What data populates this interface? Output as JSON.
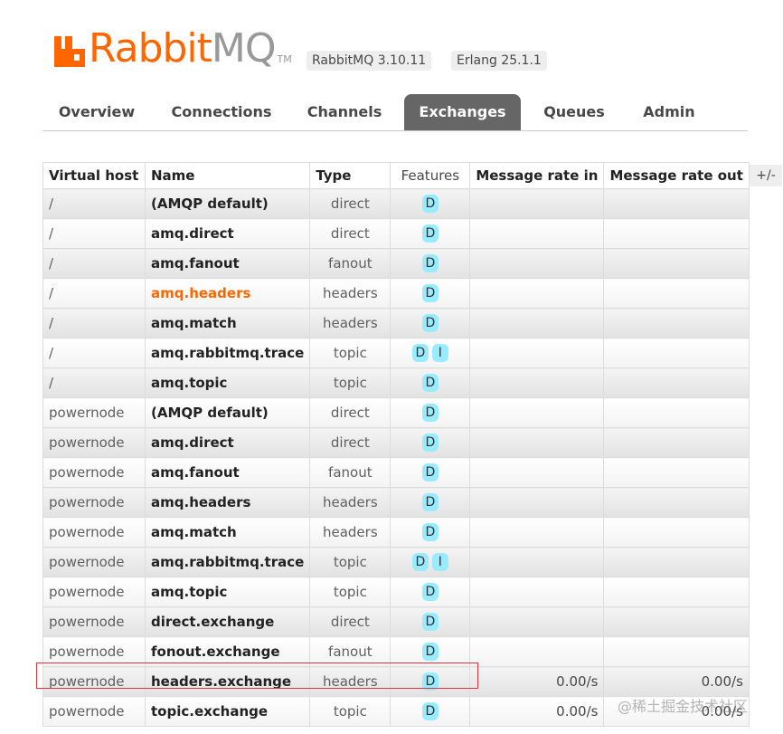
{
  "header": {
    "logo_rabbit": "Rabbit",
    "logo_mq": "MQ",
    "logo_tm": "TM",
    "version_rabbitmq": "RabbitMQ 3.10.11",
    "version_erlang": "Erlang 25.1.1"
  },
  "tabs": [
    {
      "label": "Overview",
      "active": false
    },
    {
      "label": "Connections",
      "active": false
    },
    {
      "label": "Channels",
      "active": false
    },
    {
      "label": "Exchanges",
      "active": true
    },
    {
      "label": "Queues",
      "active": false
    },
    {
      "label": "Admin",
      "active": false
    }
  ],
  "table": {
    "columns": {
      "vhost": "Virtual host",
      "name": "Name",
      "type": "Type",
      "features": "Features",
      "rate_in": "Message rate in",
      "rate_out": "Message rate out"
    },
    "column_toggle": "+/-",
    "rows": [
      {
        "vhost": "/",
        "name": "(AMQP default)",
        "type": "direct",
        "features": [
          "D"
        ],
        "rate_in": "",
        "rate_out": ""
      },
      {
        "vhost": "/",
        "name": "amq.direct",
        "type": "direct",
        "features": [
          "D"
        ],
        "rate_in": "",
        "rate_out": ""
      },
      {
        "vhost": "/",
        "name": "amq.fanout",
        "type": "fanout",
        "features": [
          "D"
        ],
        "rate_in": "",
        "rate_out": ""
      },
      {
        "vhost": "/",
        "name": "amq.headers",
        "type": "headers",
        "features": [
          "D"
        ],
        "rate_in": "",
        "rate_out": "",
        "hover": true
      },
      {
        "vhost": "/",
        "name": "amq.match",
        "type": "headers",
        "features": [
          "D"
        ],
        "rate_in": "",
        "rate_out": ""
      },
      {
        "vhost": "/",
        "name": "amq.rabbitmq.trace",
        "type": "topic",
        "features": [
          "D",
          "I"
        ],
        "rate_in": "",
        "rate_out": ""
      },
      {
        "vhost": "/",
        "name": "amq.topic",
        "type": "topic",
        "features": [
          "D"
        ],
        "rate_in": "",
        "rate_out": ""
      },
      {
        "vhost": "powernode",
        "name": "(AMQP default)",
        "type": "direct",
        "features": [
          "D"
        ],
        "rate_in": "",
        "rate_out": ""
      },
      {
        "vhost": "powernode",
        "name": "amq.direct",
        "type": "direct",
        "features": [
          "D"
        ],
        "rate_in": "",
        "rate_out": ""
      },
      {
        "vhost": "powernode",
        "name": "amq.fanout",
        "type": "fanout",
        "features": [
          "D"
        ],
        "rate_in": "",
        "rate_out": ""
      },
      {
        "vhost": "powernode",
        "name": "amq.headers",
        "type": "headers",
        "features": [
          "D"
        ],
        "rate_in": "",
        "rate_out": ""
      },
      {
        "vhost": "powernode",
        "name": "amq.match",
        "type": "headers",
        "features": [
          "D"
        ],
        "rate_in": "",
        "rate_out": ""
      },
      {
        "vhost": "powernode",
        "name": "amq.rabbitmq.trace",
        "type": "topic",
        "features": [
          "D",
          "I"
        ],
        "rate_in": "",
        "rate_out": ""
      },
      {
        "vhost": "powernode",
        "name": "amq.topic",
        "type": "topic",
        "features": [
          "D"
        ],
        "rate_in": "",
        "rate_out": ""
      },
      {
        "vhost": "powernode",
        "name": "direct.exchange",
        "type": "direct",
        "features": [
          "D"
        ],
        "rate_in": "",
        "rate_out": ""
      },
      {
        "vhost": "powernode",
        "name": "fonout.exchange",
        "type": "fanout",
        "features": [
          "D"
        ],
        "rate_in": "",
        "rate_out": ""
      },
      {
        "vhost": "powernode",
        "name": "headers.exchange",
        "type": "headers",
        "features": [
          "D"
        ],
        "rate_in": "0.00/s",
        "rate_out": "0.00/s"
      },
      {
        "vhost": "powernode",
        "name": "topic.exchange",
        "type": "topic",
        "features": [
          "D"
        ],
        "rate_in": "0.00/s",
        "rate_out": "0.00/s"
      }
    ]
  },
  "watermark": "@稀土掘金技术社区",
  "colors": {
    "brand_orange": "#ff6600",
    "tab_active_bg": "#666666",
    "feature_badge": "#99ebff",
    "annotation_red": "#e0323a"
  }
}
